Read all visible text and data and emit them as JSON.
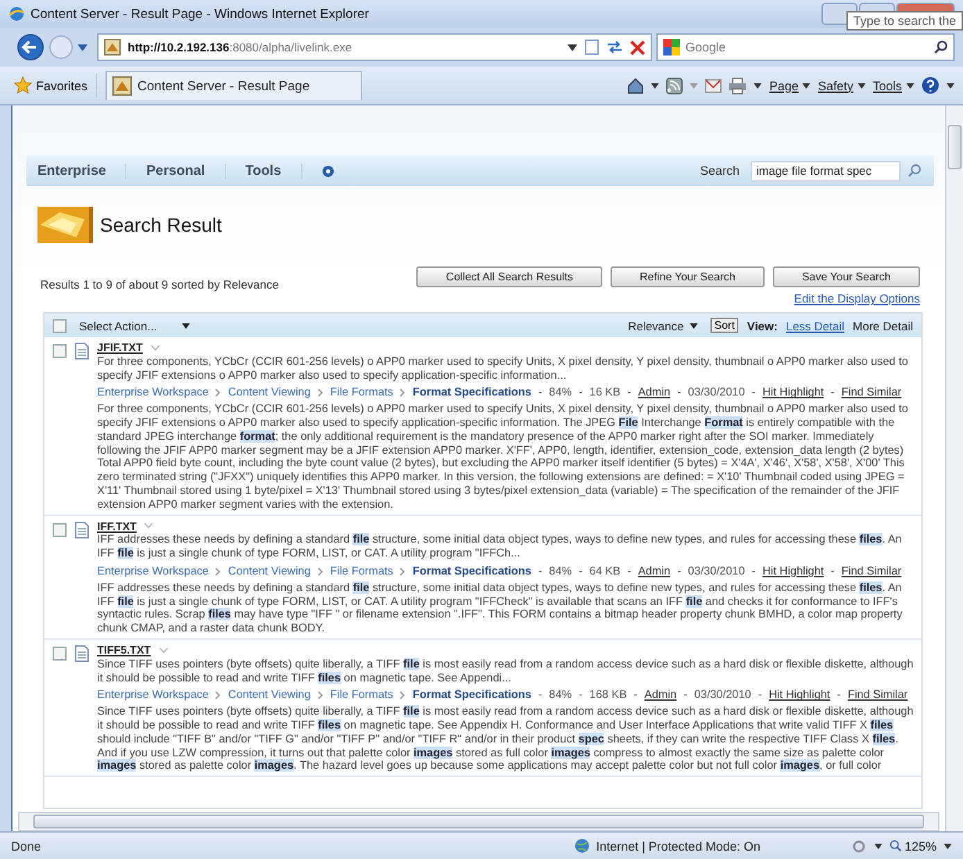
{
  "window": {
    "title": "Content Server - Result Page - Windows Internet Explorer"
  },
  "browser": {
    "address_host": "http://10.2.192.136",
    "address_rest": ":8080/alpha/livelink.exe",
    "search_engine": "Google",
    "search_placeholder": "Type to search the"
  },
  "favorites_bar": {
    "favorites": "Favorites",
    "tab": "Content Server - Result Page",
    "commands": [
      "Page",
      "Safety",
      "Tools"
    ]
  },
  "nav": {
    "menus": [
      "Enterprise",
      "Personal",
      "Tools"
    ],
    "search_label": "Search",
    "search_value": "image file format spec"
  },
  "page_title": "Search Result",
  "summary": "Results 1 to 9 of about 9 sorted by Relevance",
  "buttons": [
    "Collect All Search Results",
    "Refine Your Search",
    "Save Your Search"
  ],
  "display_options_link": "Edit the Display Options",
  "toolbar": {
    "select_all_checked": false,
    "action": "Select Action...",
    "sort_by": "Relevance",
    "sort_button": "Sort",
    "view_label": "View:",
    "views": [
      {
        "label": "Less Detail",
        "selected": false
      },
      {
        "label": "More Detail",
        "selected": true
      }
    ]
  },
  "results": [
    {
      "name": "JFIF.TXT",
      "checked": false,
      "summary": "For three components, YCbCr (CCIR 601-256 levels) o APP0 marker used to specify Units, X pixel density, Y pixel density, thumbnail o APP0 marker also used to specify JFIF extensions o APP0 marker also used to specify application-specific information...",
      "path": [
        "Enterprise Workspace",
        "Content Viewing",
        "File Formats",
        "Format Specifications"
      ],
      "meta": [
        "84%",
        "16 KB",
        "Admin",
        "03/30/2010",
        "Hit Highlight",
        "Find Similar"
      ],
      "detail": "For three components, YCbCr (CCIR 601-256 levels) o APP0 marker used to specify Units, X pixel density, Y pixel density, thumbnail o APP0 marker also used to specify JFIF extensions o APP0 marker also used to specify application-specific information. The JPEG **File** Interchange **Format** is entirely compatible with the standard JPEG interchange **format**; the only additional requirement is the mandatory presence of the APP0 marker right after the SOI marker. Immediately following the JFIF APP0 marker segment may be a JFIF extension APP0 marker. X'FF', APP0, length, identifier, extension_code, extension_data length (2 bytes) Total APP0 field byte count, including the byte count value (2 bytes), but excluding the APP0 marker itself identifier (5 bytes) = X'4A', X'46', X'58', X'58', X'00' This zero terminated string (\"JFXX\") uniquely identifies this APP0 marker. In this version, the following extensions are defined: = X'10' Thumbnail coded using JPEG = X'11' Thumbnail stored using 1 byte/pixel = X'13' Thumbnail stored using 3 bytes/pixel extension_data (variable) = The specification of the remainder of the JFIF extension APP0 marker segment varies with the extension."
    },
    {
      "name": "IFF.TXT",
      "checked": false,
      "summary": "IFF addresses these needs by defining a standard **file** structure, some initial data object types, ways to define new types, and rules for accessing these **files**. An IFF **file** is just a single chunk of type FORM, LIST, or CAT. A utility program \"IFFCh...",
      "path": [
        "Enterprise Workspace",
        "Content Viewing",
        "File Formats",
        "Format Specifications"
      ],
      "meta": [
        "84%",
        "64 KB",
        "Admin",
        "03/30/2010",
        "Hit Highlight",
        "Find Similar"
      ],
      "detail": "IFF addresses these needs by defining a standard **file** structure, some initial data object types, ways to define new types, and rules for accessing these **files**. An IFF **file** is just a single chunk of type FORM, LIST, or CAT. A utility program \"IFFCheck\" is available that scans an IFF **file** and checks it for conformance to IFF's syntactic rules. Scrap **files** may have type \"IFF \" or filename extension \".IFF\". This FORM contains a bitmap header property chunk BMHD, a color map property chunk CMAP, and a raster data chunk BODY."
    },
    {
      "name": "TIFF5.TXT",
      "checked": false,
      "summary": "Since TIFF uses pointers (byte offsets) quite liberally, a TIFF **file** is most easily read from a random access device such as a hard disk or flexible diskette, although it should be possible to read and write TIFF **files** on magnetic tape. See Appendi...",
      "path": [
        "Enterprise Workspace",
        "Content Viewing",
        "File Formats",
        "Format Specifications"
      ],
      "meta": [
        "84%",
        "168 KB",
        "Admin",
        "03/30/2010",
        "Hit Highlight",
        "Find Similar"
      ],
      "detail": "Since TIFF uses pointers (byte offsets) quite liberally, a TIFF **file** is most easily read from a random access device such as a hard disk or flexible diskette, although it should be possible to read and write TIFF **files** on magnetic tape. See Appendix H. Conformance and User Interface Applications that write valid TIFF X **files** should include \"TIFF B\" and/or \"TIFF G\" and/or \"TIFF P\" and/or \"TIFF R\" and/or in their product **spec** sheets, if they can write the respective TIFF Class X **files**. And if you use LZW compression, it turns out that palette color **images** stored as full color **images** compress to almost exactly the same size as palette color **images** stored as palette color **images**. The hazard level goes up because some applications may accept palette color but not full color **images**, or full color"
    }
  ],
  "meta_separator": "-",
  "status_bar": {
    "text": "Done",
    "zone": "Internet | Protected Mode: On",
    "zoom": "125%"
  }
}
